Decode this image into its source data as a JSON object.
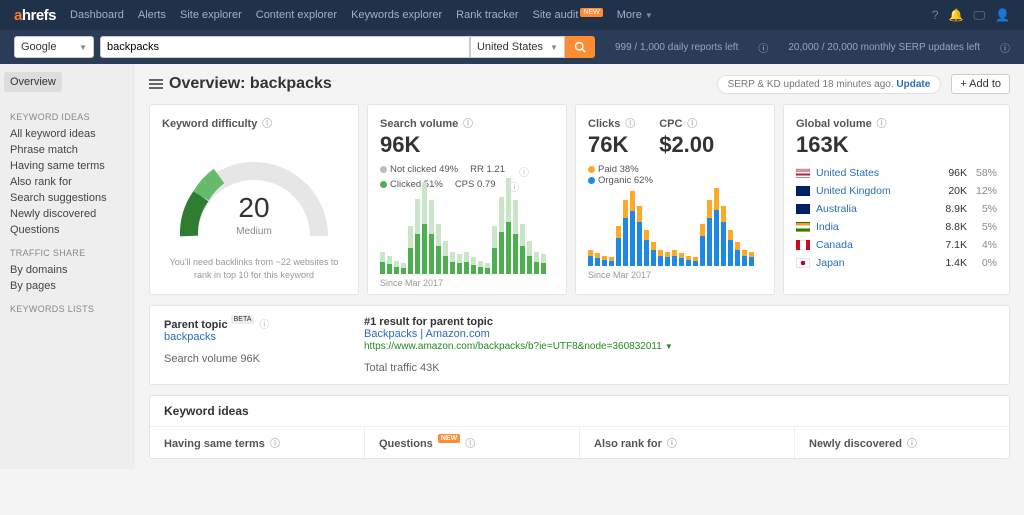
{
  "nav": {
    "logo": "ahrefs",
    "items": [
      "Dashboard",
      "Alerts",
      "Site explorer",
      "Content explorer",
      "Keywords explorer",
      "Rank tracker",
      "Site audit"
    ],
    "newOn": 6,
    "more": "More"
  },
  "search": {
    "engine": "Google",
    "keyword": "backpacks",
    "country": "United States",
    "quota1": "999 / 1,000 daily reports left",
    "quota2": "20,000 / 20,000 monthly SERP updates left"
  },
  "sidebar": {
    "active": "Overview",
    "groups": [
      {
        "head": "KEYWORD IDEAS",
        "items": [
          "All keyword ideas",
          "Phrase match",
          "Having same terms",
          "Also rank for",
          "Search suggestions",
          "Newly discovered",
          "Questions"
        ]
      },
      {
        "head": "TRAFFIC SHARE",
        "items": [
          "By domains",
          "By pages"
        ]
      },
      {
        "head": "KEYWORDS LISTS",
        "items": []
      }
    ]
  },
  "title": "Overview: backpacks",
  "serpUpdate": {
    "text": "SERP & KD updated 18 minutes ago.",
    "action": "Update"
  },
  "addTo": "+ Add to",
  "kd": {
    "label": "Keyword difficulty",
    "value": "20",
    "level": "Medium",
    "note": "You'll need backlinks from ~22 websites to rank in top 10 for this keyword"
  },
  "sv": {
    "label": "Search volume",
    "value": "96K",
    "legend": {
      "notClicked": "Not clicked 49%",
      "clicked": "Clicked 51%",
      "rr": "RR 1.21",
      "cps": "CPS 0.79"
    },
    "since": "Since Mar 2017"
  },
  "clicks": {
    "label": "Clicks",
    "value": "76K",
    "cpcLabel": "CPC",
    "cpc": "$2.00",
    "legend": {
      "paid": "Paid 38%",
      "organic": "Organic 62%"
    },
    "since": "Since Mar 2017"
  },
  "gv": {
    "label": "Global volume",
    "value": "163K",
    "rows": [
      {
        "flag": "us",
        "country": "United States",
        "val": "96K",
        "pct": "58%"
      },
      {
        "flag": "gb",
        "country": "United Kingdom",
        "val": "20K",
        "pct": "12%"
      },
      {
        "flag": "au",
        "country": "Australia",
        "val": "8.9K",
        "pct": "5%"
      },
      {
        "flag": "in",
        "country": "India",
        "val": "8.8K",
        "pct": "5%"
      },
      {
        "flag": "ca",
        "country": "Canada",
        "val": "7.1K",
        "pct": "4%"
      },
      {
        "flag": "jp",
        "country": "Japan",
        "val": "1.4K",
        "pct": "0%"
      }
    ]
  },
  "pt": {
    "label": "Parent topic",
    "topic": "backpacks",
    "svLabel": "Search volume 96K",
    "resultHead": "#1 result for parent topic",
    "resultTitle": "Backpacks | Amazon.com",
    "resultUrl": "https://www.amazon.com/backpacks/b?ie=UTF8&node=360832011",
    "traffic": "Total traffic 43K"
  },
  "ki": {
    "head": "Keyword ideas",
    "cols": [
      "Having same terms",
      "Questions",
      "Also rank for",
      "Newly discovered"
    ],
    "newOn": 1
  },
  "chart_data": [
    {
      "type": "bar",
      "title": "Search volume",
      "since": "Mar 2017",
      "series": [
        {
          "name": "Not clicked",
          "color": "#c9e6c9"
        },
        {
          "name": "Clicked",
          "color": "#4caf50"
        }
      ],
      "bars": [
        {
          "a": 10,
          "b": 12
        },
        {
          "a": 8,
          "b": 10
        },
        {
          "a": 6,
          "b": 7
        },
        {
          "a": 5,
          "b": 6
        },
        {
          "a": 22,
          "b": 26
        },
        {
          "a": 35,
          "b": 40
        },
        {
          "a": 42,
          "b": 50
        },
        {
          "a": 34,
          "b": 40
        },
        {
          "a": 22,
          "b": 28
        },
        {
          "a": 15,
          "b": 18
        },
        {
          "a": 10,
          "b": 12
        },
        {
          "a": 9,
          "b": 11
        },
        {
          "a": 10,
          "b": 12
        },
        {
          "a": 8,
          "b": 9
        },
        {
          "a": 6,
          "b": 7
        },
        {
          "a": 5,
          "b": 6
        },
        {
          "a": 22,
          "b": 26
        },
        {
          "a": 35,
          "b": 42
        },
        {
          "a": 44,
          "b": 52
        },
        {
          "a": 34,
          "b": 40
        },
        {
          "a": 22,
          "b": 28
        },
        {
          "a": 15,
          "b": 18
        },
        {
          "a": 10,
          "b": 12
        },
        {
          "a": 9,
          "b": 11
        }
      ]
    },
    {
      "type": "bar",
      "title": "Clicks",
      "since": "Mar 2017",
      "series": [
        {
          "name": "Paid",
          "color": "#ffa726"
        },
        {
          "name": "Organic",
          "color": "#1e88e5"
        }
      ],
      "bars": [
        {
          "a": 6,
          "b": 10
        },
        {
          "a": 5,
          "b": 8
        },
        {
          "a": 4,
          "b": 6
        },
        {
          "a": 4,
          "b": 5
        },
        {
          "a": 12,
          "b": 28
        },
        {
          "a": 18,
          "b": 48
        },
        {
          "a": 20,
          "b": 55
        },
        {
          "a": 16,
          "b": 44
        },
        {
          "a": 10,
          "b": 26
        },
        {
          "a": 8,
          "b": 16
        },
        {
          "a": 6,
          "b": 10
        },
        {
          "a": 5,
          "b": 9
        },
        {
          "a": 6,
          "b": 10
        },
        {
          "a": 5,
          "b": 8
        },
        {
          "a": 4,
          "b": 6
        },
        {
          "a": 4,
          "b": 5
        },
        {
          "a": 12,
          "b": 30
        },
        {
          "a": 18,
          "b": 48
        },
        {
          "a": 22,
          "b": 56
        },
        {
          "a": 16,
          "b": 44
        },
        {
          "a": 10,
          "b": 26
        },
        {
          "a": 8,
          "b": 16
        },
        {
          "a": 6,
          "b": 10
        },
        {
          "a": 5,
          "b": 9
        }
      ]
    }
  ],
  "flags": {
    "us": "linear-gradient(#b22234 0 8%,#fff 8% 16%,#b22234 16% 24%,#fff 24% 32%,#b22234 32% 40%,#fff 40% 48%,#b22234 48% 56%,#fff 56% 64%,#b22234 64% 72%,#fff 72% 80%,#b22234 80% 88%,#fff 88% 100%)",
    "gb": "conic-gradient(#012169 0 100%)",
    "au": "linear-gradient(#012169,#012169)",
    "in": "linear-gradient(#ff9933 0 33%,#fff 33% 66%,#138808 66% 100%)",
    "ca": "linear-gradient(90deg,#d80621 0 25%,#fff 25% 75%,#d80621 75% 100%)",
    "jp": "radial-gradient(circle at center,#bc002d 0 30%,#fff 32% 100%)"
  }
}
